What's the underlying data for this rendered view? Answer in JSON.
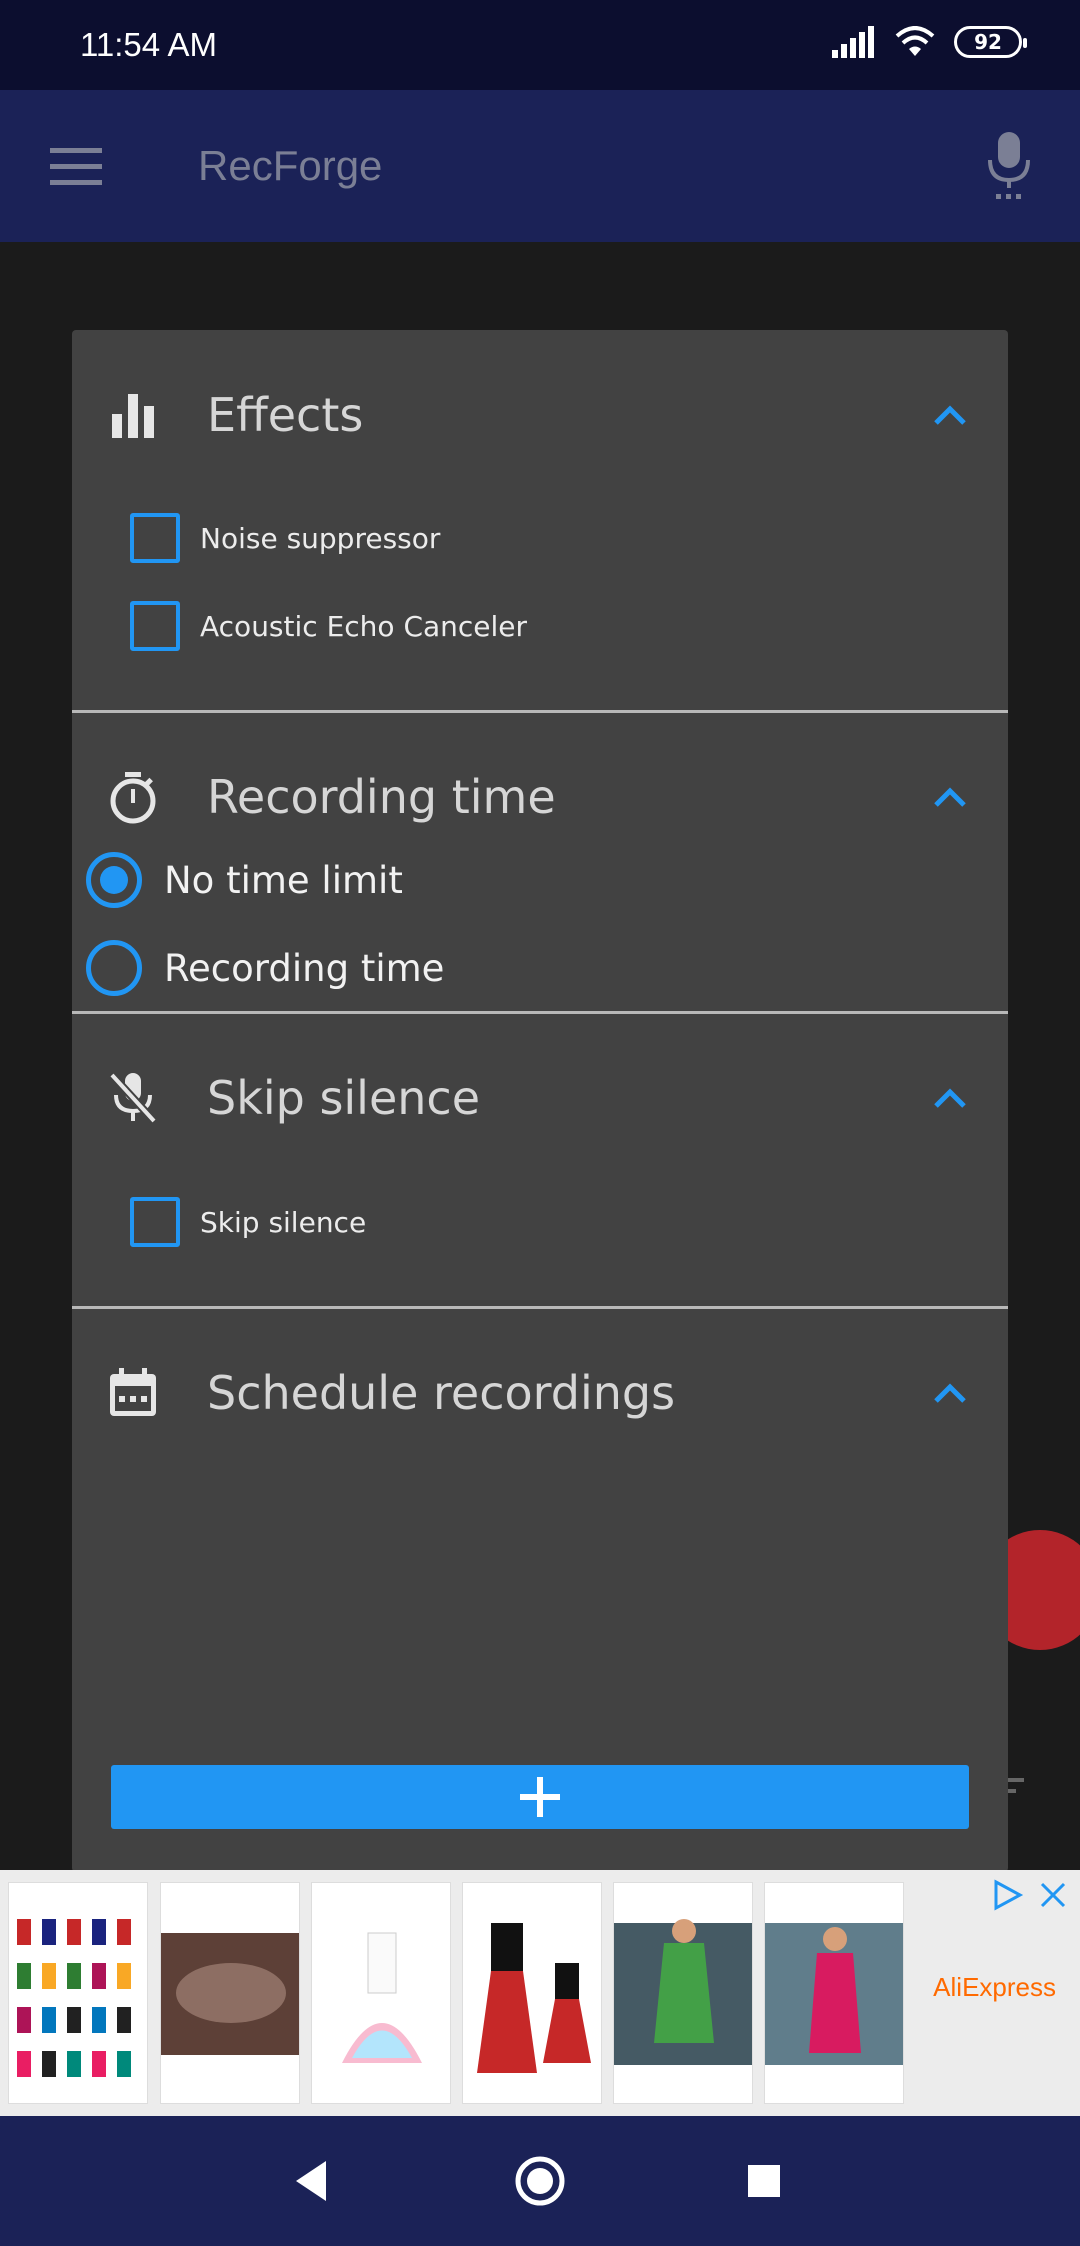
{
  "status": {
    "time": "11:54 AM",
    "battery": "92"
  },
  "app": {
    "title": "RecForge"
  },
  "sections": {
    "effects": {
      "title": "Effects",
      "options": [
        {
          "label": "Noise suppressor",
          "checked": false
        },
        {
          "label": "Acoustic Echo Canceler",
          "checked": false
        }
      ]
    },
    "recording_time": {
      "title": "Recording time",
      "options": [
        {
          "label": "No time limit",
          "selected": true
        },
        {
          "label": "Recording time",
          "selected": false
        }
      ]
    },
    "skip_silence": {
      "title": "Skip silence",
      "options": [
        {
          "label": "Skip silence",
          "checked": false
        }
      ]
    },
    "schedule": {
      "title": "Schedule recordings"
    }
  },
  "ad": {
    "brand": "AliExpress"
  },
  "colors": {
    "accent": "#2196f3",
    "app_bar": "#1b2257",
    "dialog": "#424242",
    "fab": "#b3242a"
  },
  "icons": {
    "effects": "bar-chart-icon",
    "recording_time": "stopwatch-icon",
    "skip_silence": "mic-off-icon",
    "schedule": "calendar-icon",
    "add": "plus-icon"
  }
}
